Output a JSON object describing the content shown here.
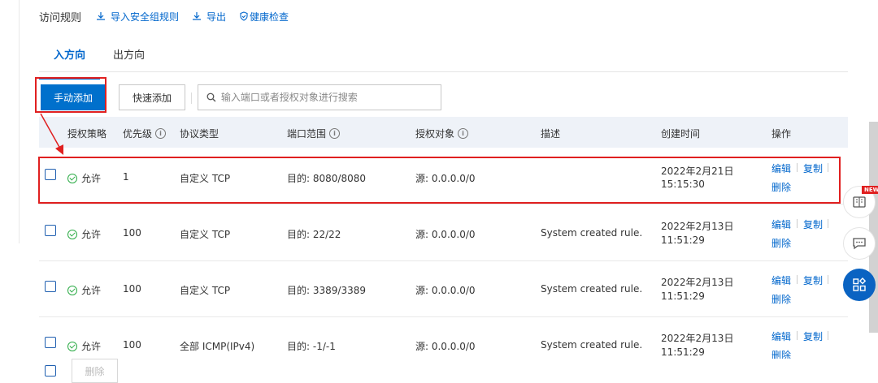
{
  "header": {
    "title": "访问规则",
    "import_label": "导入安全组规则",
    "export_label": "导出",
    "health_label": "健康检查"
  },
  "tabs": [
    {
      "label": "入方向",
      "active": true
    },
    {
      "label": "出方向",
      "active": false
    }
  ],
  "toolbar": {
    "add_label": "手动添加",
    "quick_add_label": "快速添加",
    "search_placeholder": "输入端口或者授权对象进行搜索"
  },
  "table": {
    "columns": [
      "授权策略",
      "优先级",
      "协议类型",
      "端口范围",
      "授权对象",
      "描述",
      "创建时间",
      "操作"
    ],
    "rows": [
      {
        "policy": "允许",
        "priority": "1",
        "protocol": "自定义 TCP",
        "port": "目的: 8080/8080",
        "source": "源: 0.0.0.0/0",
        "desc": "",
        "date": "2022年2月21日",
        "time": "15:15:30"
      },
      {
        "policy": "允许",
        "priority": "100",
        "protocol": "自定义 TCP",
        "port": "目的: 22/22",
        "source": "源: 0.0.0.0/0",
        "desc": "System created rule.",
        "date": "2022年2月13日",
        "time": "11:51:29"
      },
      {
        "policy": "允许",
        "priority": "100",
        "protocol": "自定义 TCP",
        "port": "目的: 3389/3389",
        "source": "源: 0.0.0.0/0",
        "desc": "System created rule.",
        "date": "2022年2月13日",
        "time": "11:51:29"
      },
      {
        "policy": "允许",
        "priority": "100",
        "protocol": "全部 ICMP(IPv4)",
        "port": "目的: -1/-1",
        "source": "源: 0.0.0.0/0",
        "desc": "System created rule.",
        "date": "2022年2月13日",
        "time": "11:51:29"
      }
    ],
    "actions": {
      "edit": "编辑",
      "copy": "复制",
      "delete": "删除"
    }
  },
  "footer": {
    "delete_label": "删除"
  },
  "floating": {
    "new_badge": "NEW"
  },
  "colors": {
    "primary": "#0066cc",
    "annotation": "#e02020",
    "allow_green": "#2bab45",
    "header_bg": "#eef2f8"
  }
}
